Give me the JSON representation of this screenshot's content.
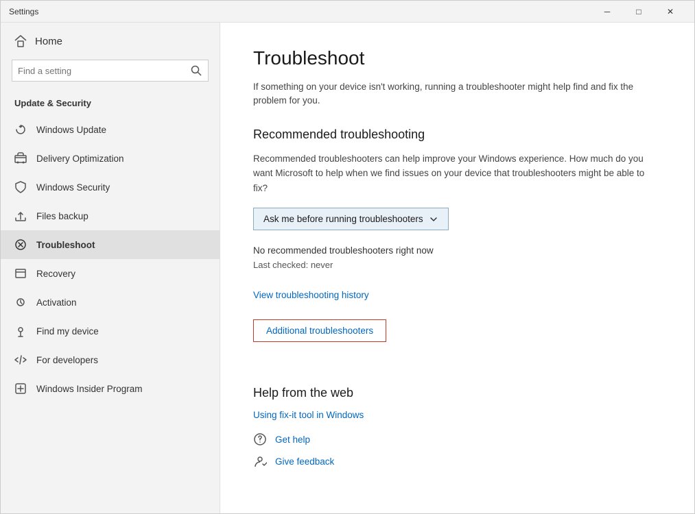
{
  "titlebar": {
    "title": "Settings",
    "minimize": "─",
    "maximize": "□",
    "close": "✕"
  },
  "sidebar": {
    "home_label": "Home",
    "search_placeholder": "Find a setting",
    "section_title": "Update & Security",
    "nav_items": [
      {
        "id": "windows-update",
        "label": "Windows Update",
        "icon": "update"
      },
      {
        "id": "delivery-optimization",
        "label": "Delivery Optimization",
        "icon": "delivery"
      },
      {
        "id": "windows-security",
        "label": "Windows Security",
        "icon": "security"
      },
      {
        "id": "files-backup",
        "label": "Files backup",
        "icon": "backup"
      },
      {
        "id": "troubleshoot",
        "label": "Troubleshoot",
        "icon": "troubleshoot",
        "active": true
      },
      {
        "id": "recovery",
        "label": "Recovery",
        "icon": "recovery"
      },
      {
        "id": "activation",
        "label": "Activation",
        "icon": "activation"
      },
      {
        "id": "find-my-device",
        "label": "Find my device",
        "icon": "find"
      },
      {
        "id": "for-developers",
        "label": "For developers",
        "icon": "developers"
      },
      {
        "id": "windows-insider",
        "label": "Windows Insider Program",
        "icon": "insider"
      }
    ]
  },
  "main": {
    "page_title": "Troubleshoot",
    "page_description": "If something on your device isn't working, running a troubleshooter might help find and fix the problem for you.",
    "recommended_title": "Recommended troubleshooting",
    "recommended_description": "Recommended troubleshooters can help improve your Windows experience. How much do you want Microsoft to help when we find issues on your device that troubleshooters might be able to fix?",
    "dropdown_label": "Ask me before running troubleshooters",
    "status_text": "No recommended troubleshooters right now",
    "status_sub": "Last checked: never",
    "history_link": "View troubleshooting history",
    "additional_link": "Additional troubleshooters",
    "help_title": "Help from the web",
    "fix_link": "Using fix-it tool in Windows",
    "get_help": "Get help",
    "give_feedback": "Give feedback"
  }
}
